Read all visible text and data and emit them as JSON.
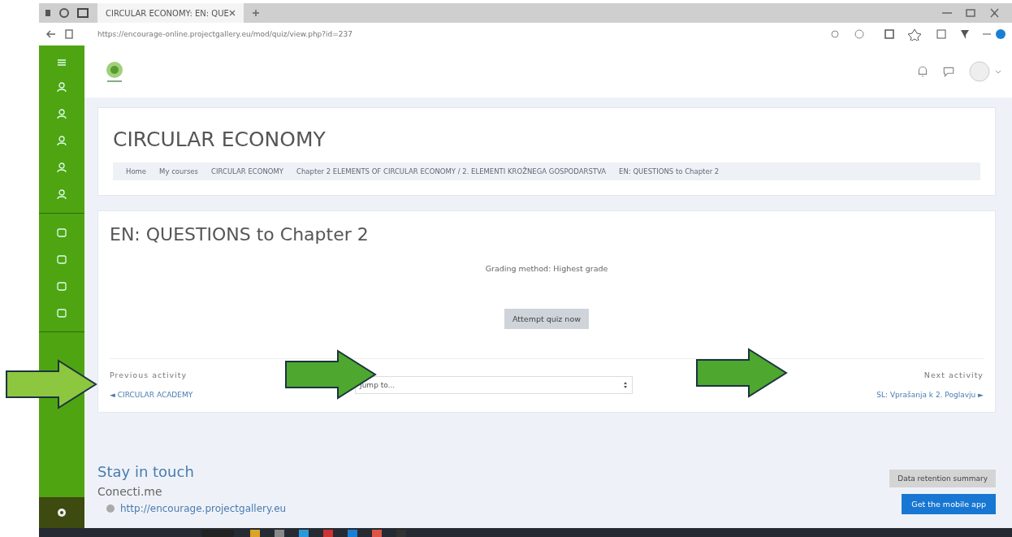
{
  "browser": {
    "tab_title": "CIRCULAR ECONOMY: EN: QUE",
    "url": "https://encourage-online.projectgallery.eu/mod/quiz/view.php?id=237"
  },
  "course": {
    "title": "CIRCULAR ECONOMY",
    "breadcrumbs": [
      "Home",
      "My courses",
      "CIRCULAR ECONOMY",
      "Chapter 2 ELEMENTS OF CIRCULAR ECONOMY / 2. ELEMENTI KROŽNEGA GOSPODARSTVA",
      "EN: QUESTIONS to Chapter 2"
    ]
  },
  "quiz": {
    "title": "EN: QUESTIONS to Chapter 2",
    "grading": "Grading method: Highest grade",
    "button": "Attempt quiz now"
  },
  "navigation": {
    "previous_label": "Previous activity",
    "previous_link": "◄ CIRCULAR ACADEMY",
    "jump_placeholder": "Jump to...",
    "next_label": "Next activity",
    "next_link": "SL: Vprašanja k 2. Poglavju ►"
  },
  "footer": {
    "heading": "Stay in touch",
    "name": "Conecti.me",
    "link": "http://encourage.projectgallery.eu",
    "data_button": "Data retention summary",
    "app_button": "Get the mobile app"
  }
}
